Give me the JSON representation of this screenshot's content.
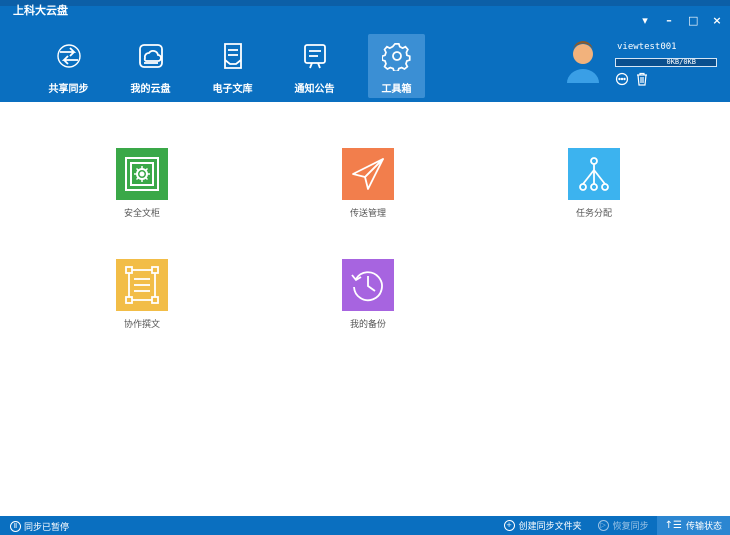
{
  "window": {
    "title": "上科大云盘",
    "controls": {
      "menu": "▾",
      "minimize": "–",
      "maximize": "□",
      "close": "×"
    }
  },
  "nav": {
    "items": [
      {
        "label": "共享同步",
        "icon": "sync-icon"
      },
      {
        "label": "我的云盘",
        "icon": "cloud-drive-icon"
      },
      {
        "label": "电子文库",
        "icon": "library-icon"
      },
      {
        "label": "通知公告",
        "icon": "notice-icon"
      },
      {
        "label": "工具箱",
        "icon": "toolbox-gear-icon",
        "active": true
      }
    ]
  },
  "user": {
    "name": "viewtest001",
    "quota_text": "0KB/0KB",
    "quota_used_fraction": 0.0
  },
  "tools": [
    {
      "label": "安全文柜",
      "icon": "safe-icon",
      "color": "#3aa848"
    },
    {
      "label": "传送管理",
      "icon": "paper-plane-icon",
      "color": "#f27e4c"
    },
    {
      "label": "任务分配",
      "icon": "hierarchy-icon",
      "color": "#3cb3ef"
    },
    {
      "label": "协作撰文",
      "icon": "document-icon",
      "color": "#f2bd47"
    },
    {
      "label": "我的备份",
      "icon": "history-icon",
      "color": "#a764e0"
    }
  ],
  "status": {
    "sync_state": "同步已暂停",
    "create_folder": "创建同步文件夹",
    "resume_sync": "恢复同步",
    "transfer_status": "传输状态"
  },
  "colors": {
    "brand_blue": "#0a6fc0",
    "active_tab": "#3b8fd4"
  }
}
